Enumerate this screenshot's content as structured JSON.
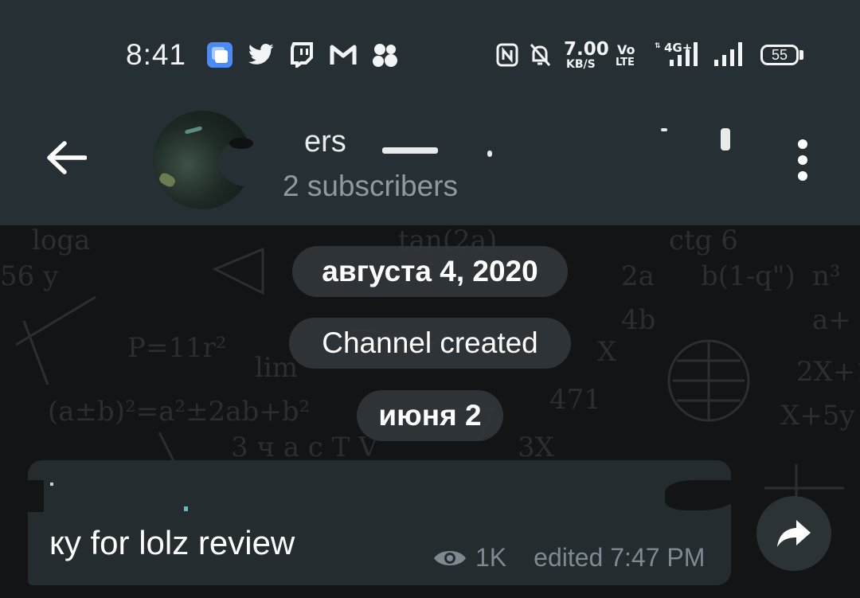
{
  "status_bar": {
    "time": "8:41",
    "net_speed_value": "7.00",
    "net_speed_unit": "KB/S",
    "volte_top": "Vo",
    "volte_bottom": "LTE",
    "network_type": "4G+",
    "battery": "55",
    "icons": [
      "app-switch-icon",
      "twitter-icon",
      "twitch-icon",
      "gmail-icon",
      "team-icon",
      "nfc-icon",
      "bell-off-icon",
      "signal-icon",
      "signal-icon-2",
      "battery-icon"
    ]
  },
  "header": {
    "title": "ers",
    "subtitle": "2 subscribers",
    "back_icon": "arrow-left-icon",
    "menu_icon": "more-vertical-icon"
  },
  "chat": {
    "date_1": "августа 4, 2020",
    "service_message": "Channel created",
    "date_2": "июня 2",
    "message": {
      "text": "ку for lolz review",
      "views": "1K",
      "edited": "edited 7:47 PM"
    },
    "share_icon": "share-arrow-icon"
  },
  "colors": {
    "header_bg": "#263034",
    "chat_bg": "#121415",
    "bubble_bg": "#252c30",
    "pill_bg": "#30363a",
    "meta_text": "#7d8a90"
  }
}
